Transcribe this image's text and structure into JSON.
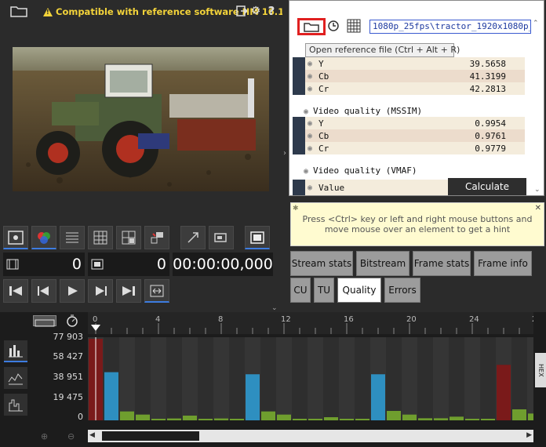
{
  "header": {
    "compat_text": "Compatible with reference software HM 16.15"
  },
  "counters": {
    "frame_a": "0",
    "frame_b": "0",
    "timecode": "00:00:00,000"
  },
  "stats": {
    "path": "1080p_25fps\\tractor_1920x1080p_",
    "tooltip": "Open reference file (Ctrl + Alt + R)",
    "psnr_rows": [
      {
        "label": "Y",
        "value": "39.5658"
      },
      {
        "label": "Cb",
        "value": "41.3199"
      },
      {
        "label": "Cr",
        "value": "42.2813"
      }
    ],
    "ssim_title": "Video quality (MSSIM)",
    "ssim_rows": [
      {
        "label": "Y",
        "value": "0.9954"
      },
      {
        "label": "Cb",
        "value": "0.9761"
      },
      {
        "label": "Cr",
        "value": "0.9779"
      }
    ],
    "vmaf_title": "Video quality (VMAF)",
    "vmaf_label": "Value",
    "calc_label": "Calculate"
  },
  "hint": {
    "line1": "Press <Ctrl> key or left and right mouse buttons and",
    "line2": "move mouse over an element to get a hint"
  },
  "tabs": [
    {
      "label": "Stream stats"
    },
    {
      "label": "Bitstream"
    },
    {
      "label": "Frame stats"
    },
    {
      "label": "Frame info"
    },
    {
      "label": "CU"
    },
    {
      "label": "TU"
    },
    {
      "label": "Quality"
    },
    {
      "label": "Errors"
    }
  ],
  "timeline": {
    "ticks": [
      "0",
      "4",
      "8",
      "12",
      "16",
      "20",
      "24",
      "2"
    ],
    "hex_label": "HEX"
  },
  "colors": {
    "i_frame": "#7a1a1a",
    "p_frame": "#2e8fc0",
    "b_frame": "#6f9e2e",
    "accent": "#3d7ce0"
  },
  "chart_data": {
    "type": "bar",
    "ylabels": [
      "77 903",
      "58 427",
      "38 951",
      "19 475",
      "0"
    ],
    "ylim": [
      0,
      77903
    ],
    "x": [
      0,
      1,
      2,
      3,
      4,
      5,
      6,
      7,
      8,
      9,
      10,
      11,
      12,
      13,
      14,
      15,
      16,
      17,
      18,
      19,
      20,
      21,
      22,
      23,
      24,
      25,
      26
    ],
    "values": [
      77903,
      46000,
      8500,
      5500,
      1500,
      1800,
      4500,
      1500,
      1800,
      1500,
      44000,
      8500,
      5500,
      1500,
      1500,
      3000,
      1500,
      1500,
      44000,
      9000,
      5500,
      2000,
      2000,
      3500,
      1500,
      1500,
      53000,
      10500,
      6500
    ],
    "frame_types": [
      "I",
      "P",
      "B",
      "B",
      "B",
      "B",
      "B",
      "B",
      "B",
      "B",
      "P",
      "B",
      "B",
      "B",
      "B",
      "B",
      "B",
      "B",
      "P",
      "B",
      "B",
      "B",
      "B",
      "B",
      "B",
      "B",
      "I",
      "B",
      "B"
    ]
  }
}
